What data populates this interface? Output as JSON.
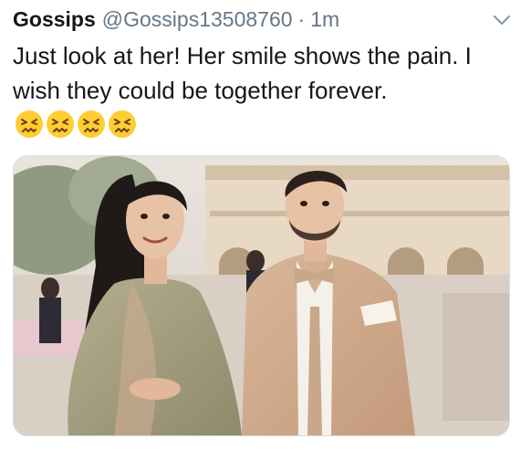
{
  "tweet": {
    "display_name": "Gossips",
    "handle": "@Gossips13508760",
    "separator": "·",
    "timestamp": "1m",
    "text": "Just look at her! Her smile shows the pain. I wish they could be together forever.",
    "emoji_name": "persevering-face-icon",
    "emoji_count": 4
  },
  "icons": {
    "menu": "chevron-down-icon"
  },
  "colors": {
    "text": "#14171a",
    "secondary": "#657786",
    "emoji": "#ffcc33"
  }
}
